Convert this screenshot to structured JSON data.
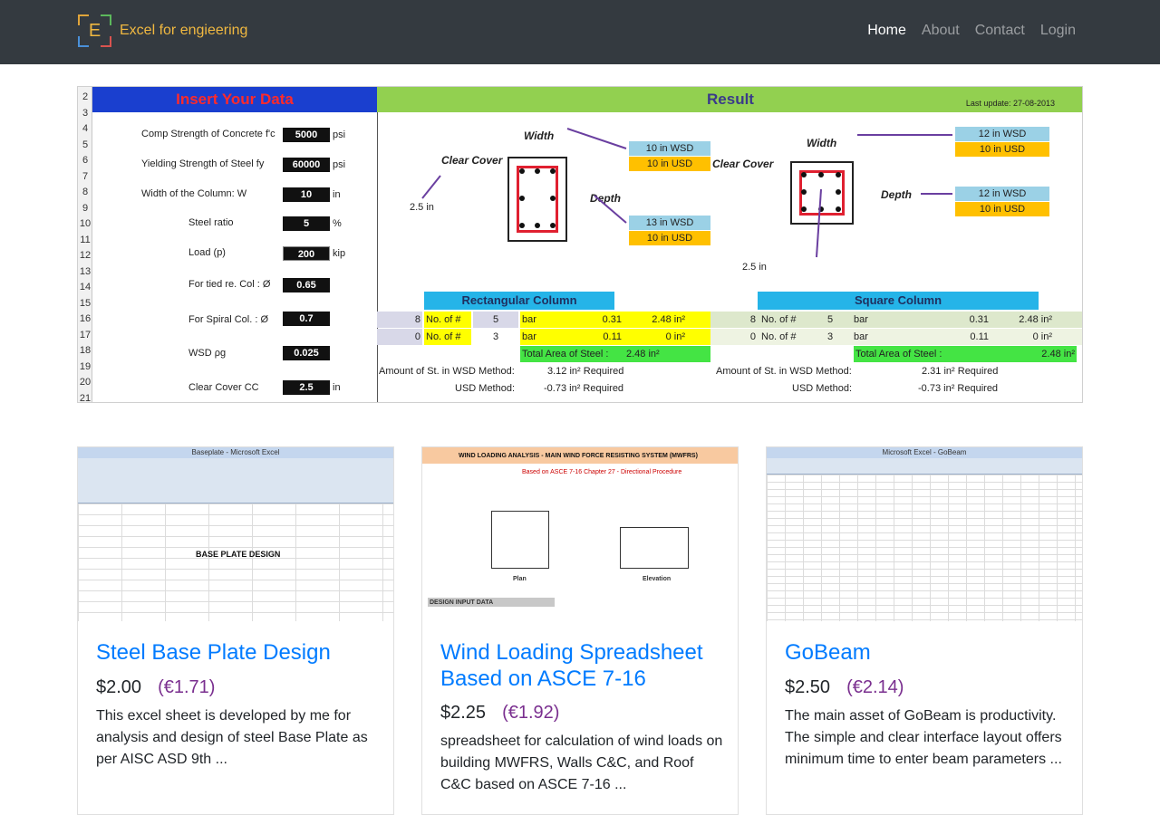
{
  "nav": {
    "brand_letter": "E",
    "brand_text": "Excel for engieering",
    "links": [
      "Home",
      "About",
      "Contact",
      "Login"
    ]
  },
  "hero": {
    "insert_title": "Insert Your Data",
    "result_title": "Result",
    "last_update": "Last update: 27-08-2013",
    "row_numbers": [
      "2",
      "3",
      "4",
      "5",
      "6",
      "7",
      "8",
      "9",
      "10",
      "11",
      "12",
      "13",
      "14",
      "15",
      "16",
      "17",
      "18",
      "19",
      "20",
      "21"
    ],
    "inputs": [
      {
        "label": "Comp Strength of Concrete f'c",
        "value": "5000",
        "unit": "psi"
      },
      {
        "label": "Yielding Strength of Steel   fy",
        "value": "60000",
        "unit": "psi"
      },
      {
        "label": "Width of the Column:  W",
        "value": "10",
        "unit": "in"
      },
      {
        "label": "Steel ratio",
        "value": "5",
        "unit": "%"
      },
      {
        "label": "Load (p)",
        "value": "200",
        "unit": "kip"
      },
      {
        "label": "For tied re. Col : Ø",
        "value": "0.65",
        "unit": ""
      },
      {
        "label": "For Spiral Col. : Ø",
        "value": "0.7",
        "unit": ""
      },
      {
        "label": "WSD ρg",
        "value": "0.025",
        "unit": ""
      },
      {
        "label": "Clear Cover   CC",
        "value": "2.5",
        "unit": "in"
      }
    ],
    "diagram": {
      "width_label": "Width",
      "depth_label": "Depth",
      "clear_cover_label": "Clear Cover",
      "cover_value": "2.5  in",
      "rect_width_wsd": "10  in  WSD",
      "rect_width_usd": "10  in  USD",
      "rect_depth_wsd": "13  in  WSD",
      "rect_depth_usd": "10  in  USD",
      "sq_width_wsd": "12 in WSD",
      "sq_width_usd": "10 in  USD",
      "sq_depth_wsd": "12  in  WSD",
      "sq_depth_usd": "10  in  USD"
    },
    "rect_column": {
      "title": "Rectangular Column",
      "row1": {
        "n": "8",
        "label": "No. of #",
        "size": "5",
        "bar": "bar",
        "area": "0.31",
        "total": "2.48  in²"
      },
      "row2": {
        "n": "0",
        "label": "No. of #",
        "size": "3",
        "bar": "bar",
        "area": "0.11",
        "total": "0  in²"
      },
      "total_label": "Total Area of Steel :",
      "total_value": "2.48     in²"
    },
    "sq_column": {
      "title": "Square Column",
      "row1": {
        "n": "8",
        "label": "No. of #",
        "size": "5",
        "bar": "bar",
        "area": "0.31",
        "total": "2.48 in²"
      },
      "row2": {
        "n": "0",
        "label": "No. of #",
        "size": "3",
        "bar": "bar",
        "area": "0.11",
        "total": "0 in²"
      },
      "total_label": "Total Area of Steel :",
      "total_value": "2.48 in²"
    },
    "summary": {
      "wsd_label": "Amount of St. in WSD Method:",
      "usd_label": "USD Method:",
      "rect_wsd": "3.12 in² Required",
      "rect_usd": "-0.73 in² Required",
      "sq_wsd": "2.31 in² Required",
      "sq_usd": "-0.73 in² Required"
    }
  },
  "cards": [
    {
      "title": "Steel Base Plate Design",
      "price": "$2.00",
      "price_eur": "(€1.71)",
      "description": "This excel sheet is developed by me for analysis and design of steel Base Plate as per AISC ASD 9th ...",
      "thumb_title": "BASE PLATE DESIGN",
      "thumb_window": "Baseplate - Microsoft Excel"
    },
    {
      "title": "Wind Loading Spreadsheet Based on ASCE 7-16",
      "price": "$2.25",
      "price_eur": "(€1.92)",
      "description": "spreadsheet for calculation of wind loads on building MWFRS, Walls C&C, and Roof C&C based on ASCE 7-16 ...",
      "thumb_title": "WIND LOADING ANALYSIS - MAIN WIND FORCE RESISTING SYSTEM (MWFRS)",
      "thumb_sub": "Based on ASCE 7-16 Chapter 27 - Directional Procedure",
      "thumb_plan": "Plan",
      "thumb_elev": "Elevation",
      "thumb_input": "DESIGN INPUT DATA"
    },
    {
      "title": "GoBeam",
      "price": "$2.50",
      "price_eur": "(€2.14)",
      "description": "The main asset of GoBeam is productivity. The simple and clear interface layout offers minimum time to enter beam parameters ...",
      "thumb_window": "Microsoft Excel - GoBeam"
    }
  ],
  "colors": {
    "navbar": "#343a40",
    "brand": "#f0b840",
    "link": "#007bff",
    "eur": "#7a2f8f"
  }
}
